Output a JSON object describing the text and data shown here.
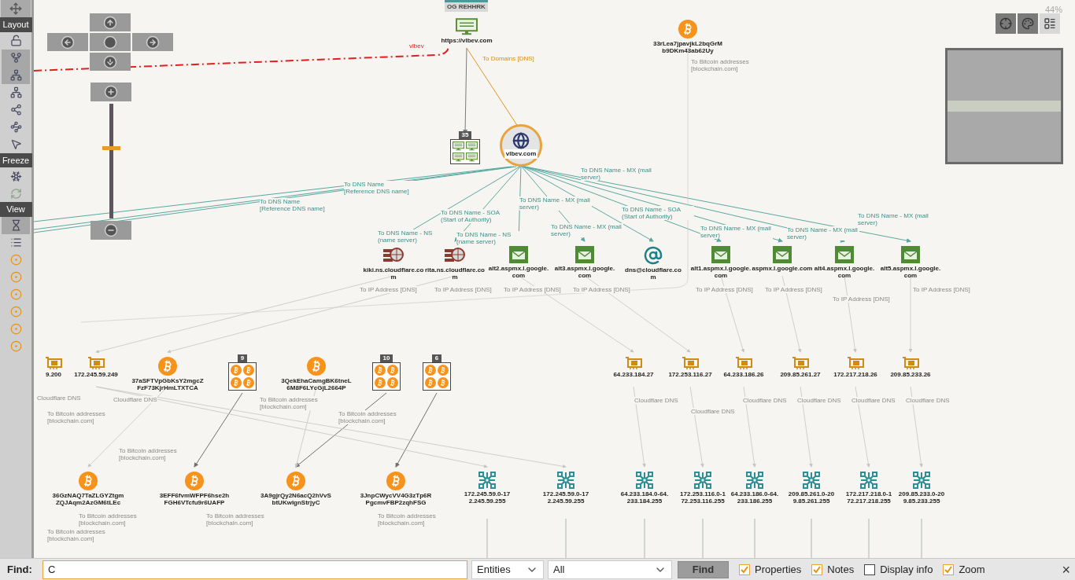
{
  "sidebar": {
    "pan_tool": {
      "selected": true
    },
    "sections": [
      {
        "label": "Layout",
        "tools": [
          {
            "selected": false
          },
          {
            "selected": true
          },
          {
            "selected": true
          },
          {
            "selected": false
          },
          {
            "selected": false
          },
          {
            "selected": false
          },
          {
            "selected": false
          }
        ]
      },
      {
        "label": "Freeze",
        "tools": [
          {
            "selected": false
          },
          {
            "selected": false
          }
        ]
      },
      {
        "label": "View",
        "tools": [
          {
            "selected": true
          },
          {
            "selected": false
          },
          {
            "selected": false
          },
          {
            "selected": false
          },
          {
            "selected": false
          },
          {
            "selected": false
          },
          {
            "selected": false
          },
          {
            "selected": false
          }
        ]
      }
    ]
  },
  "zoom_slider": {
    "level": 0.62
  },
  "zoom_percent": "44%",
  "view_buttons": [
    {
      "selected": false
    },
    {
      "selected": false
    },
    {
      "selected": true
    }
  ],
  "note": "OG REHHRK",
  "nodes": [
    {
      "kind": "website",
      "label": "https://vlbev.com"
    },
    {
      "kind": "website_group",
      "count": "35"
    },
    {
      "kind": "domain",
      "label": "vlbev.com"
    },
    {
      "kind": "bitcoin",
      "label": "33rLea7jpavjkL2bqGrMb9DKm43ab62Uy"
    },
    {
      "kind": "ns",
      "label": "kiki.ns.cloudflare.com"
    },
    {
      "kind": "ns",
      "label": "rita.ns.cloudflare.com"
    },
    {
      "kind": "mx",
      "label": "alt2.aspmx.l.google.com"
    },
    {
      "kind": "mx",
      "label": "alt3.aspmx.l.google.com"
    },
    {
      "kind": "email",
      "label": "dns@cloudflare.com"
    },
    {
      "kind": "mx",
      "label": "alt1.aspmx.l.google.com"
    },
    {
      "kind": "mx",
      "label": "aspmx.l.google.com"
    },
    {
      "kind": "mx",
      "label": "alt4.aspmx.l.google.com"
    },
    {
      "kind": "mx",
      "label": "alt5.aspmx.l.google.com"
    },
    {
      "kind": "ip",
      "label": "9.200"
    },
    {
      "kind": "ip",
      "label": "172.245.59.249"
    },
    {
      "kind": "bitcoin",
      "label": "37aSFTVpGbKsY2mgcZFzF73KjrHmLTXTCA"
    },
    {
      "kind": "bitcoin_group",
      "count": "9"
    },
    {
      "kind": "bitcoin",
      "label": "3QekEhaCamgBK6tneL6M8F6LYcGjL2664P"
    },
    {
      "kind": "bitcoin_group",
      "count": "10"
    },
    {
      "kind": "bitcoin_group",
      "count": "6"
    },
    {
      "kind": "ip",
      "label": "64.233.184.27"
    },
    {
      "kind": "ip",
      "label": "172.253.116.27"
    },
    {
      "kind": "ip",
      "label": "64.233.186.26"
    },
    {
      "kind": "ip",
      "label": "209.85.261.27"
    },
    {
      "kind": "ip",
      "label": "172.217.218.26"
    },
    {
      "kind": "ip",
      "label": "209.85.233.26"
    },
    {
      "kind": "bitcoin",
      "label": "36GzNAQ7TaZLGYZtgmZQJAqm2AzGM6tLEc"
    },
    {
      "kind": "bitcoin",
      "label": "3EFF6fvmWFPF6hse2hFGH6VTcfu9r6UAFP"
    },
    {
      "kind": "bitcoin",
      "label": "3A9gjrQy2N6acQ2hVvSbtUKwlgnStrjyC"
    },
    {
      "kind": "bitcoin",
      "label": "3JnpCWycVV4G3zTp6RPgcmvFBP2zqhFSG"
    },
    {
      "kind": "netblock",
      "label": "172.245.59.0-172.245.59.255"
    },
    {
      "kind": "netblock",
      "label": "172.245.59.0-172.245.59.255"
    },
    {
      "kind": "netblock",
      "label": "64.233.184.0-64.233.184.255"
    },
    {
      "kind": "netblock",
      "label": "172.253.116.0-172.253.116.255"
    },
    {
      "kind": "netblock",
      "label": "64.233.186.0-64.233.186.255"
    },
    {
      "kind": "netblock",
      "label": "209.85.261.0-209.85.261.255"
    },
    {
      "kind": "netblock",
      "label": "172.217.218.0-172.217.218.255"
    },
    {
      "kind": "netblock",
      "label": "209.85.233.0-209.85.233.255"
    }
  ],
  "edge_labels": [
    {
      "text": "vlbev",
      "kind": "manual"
    },
    {
      "text": "To Domains [DNS]",
      "kind": "domain"
    },
    {
      "text": "To Bitcoin addresses [blockchain.com]",
      "kind": "plain"
    },
    {
      "text": "To DNS Name - MX (mail server)",
      "kind": "dns"
    },
    {
      "text": "To DNS Name [Reference DNS name]",
      "kind": "dns"
    },
    {
      "text": "To DNS Name [Reference DNS name]",
      "kind": "dns"
    },
    {
      "text": "To DNS Name - MX (mail server)",
      "kind": "dns"
    },
    {
      "text": "To DNS Name - SOA (Start of Authority)",
      "kind": "dns"
    },
    {
      "text": "To DNS Name - SOA (Start of Authority)",
      "kind": "dns"
    },
    {
      "text": "To DNS Name - MX (mail server)",
      "kind": "dns"
    },
    {
      "text": "To DNS Name - NS (name server)",
      "kind": "dns"
    },
    {
      "text": "To DNS Name - NS (name server)",
      "kind": "dns"
    },
    {
      "text": "To DNS Name - MX (mail server)",
      "kind": "dns"
    },
    {
      "text": "To DNS Name - MX (mail server)",
      "kind": "dns"
    },
    {
      "text": "To DNS Name - MX (mail server)",
      "kind": "dns"
    },
    {
      "text": "To IP Address [DNS]",
      "kind": "plain"
    },
    {
      "text": "To IP Address [DNS]",
      "kind": "plain"
    },
    {
      "text": "To IP Address [DNS]",
      "kind": "plain"
    },
    {
      "text": "To IP Address [DNS]",
      "kind": "plain"
    },
    {
      "text": "To IP Address [DNS]",
      "kind": "plain"
    },
    {
      "text": "To IP Address [DNS]",
      "kind": "plain"
    },
    {
      "text": "To IP Address [DNS]",
      "kind": "plain"
    },
    {
      "text": "To IP Address [DNS]",
      "kind": "plain"
    },
    {
      "text": "Cloudflare DNS",
      "kind": "plain"
    },
    {
      "text": "Cloudflare DNS",
      "kind": "plain"
    },
    {
      "text": "To Bitcoin addresses [blockchain.com]",
      "kind": "plain"
    },
    {
      "text": "To Bitcoin addresses [blockchain.com]",
      "kind": "plain"
    },
    {
      "text": "To Bitcoin addresses [blockchain.com]",
      "kind": "plain"
    },
    {
      "text": "To Bitcoin addresses [blockchain.com]",
      "kind": "plain"
    },
    {
      "text": "Cloudflare DNS",
      "kind": "plain"
    },
    {
      "text": "Cloudflare DNS",
      "kind": "plain"
    },
    {
      "text": "Cloudflare DNS",
      "kind": "plain"
    },
    {
      "text": "Cloudflare DNS",
      "kind": "plain"
    },
    {
      "text": "Cloudflare DNS",
      "kind": "plain"
    },
    {
      "text": "Cloudflare DNS",
      "kind": "plain"
    },
    {
      "text": "To Bitcoin addresses [blockchain.com]",
      "kind": "plain"
    },
    {
      "text": "To Bitcoin addresses [blockchain.com]",
      "kind": "plain"
    },
    {
      "text": "To Bitcoin addresses [blockchain.com]",
      "kind": "plain"
    },
    {
      "text": "To Bitcoin addresses [blockchain.com]",
      "kind": "plain"
    }
  ],
  "find_bar": {
    "label": "Find:",
    "value": "C",
    "scope": "Entities",
    "filter": "All",
    "button": "Find",
    "options": [
      {
        "label": "Properties",
        "checked": true
      },
      {
        "label": "Notes",
        "checked": true
      },
      {
        "label": "Display info",
        "checked": false
      },
      {
        "label": "Zoom",
        "checked": true
      }
    ],
    "close": "×"
  }
}
